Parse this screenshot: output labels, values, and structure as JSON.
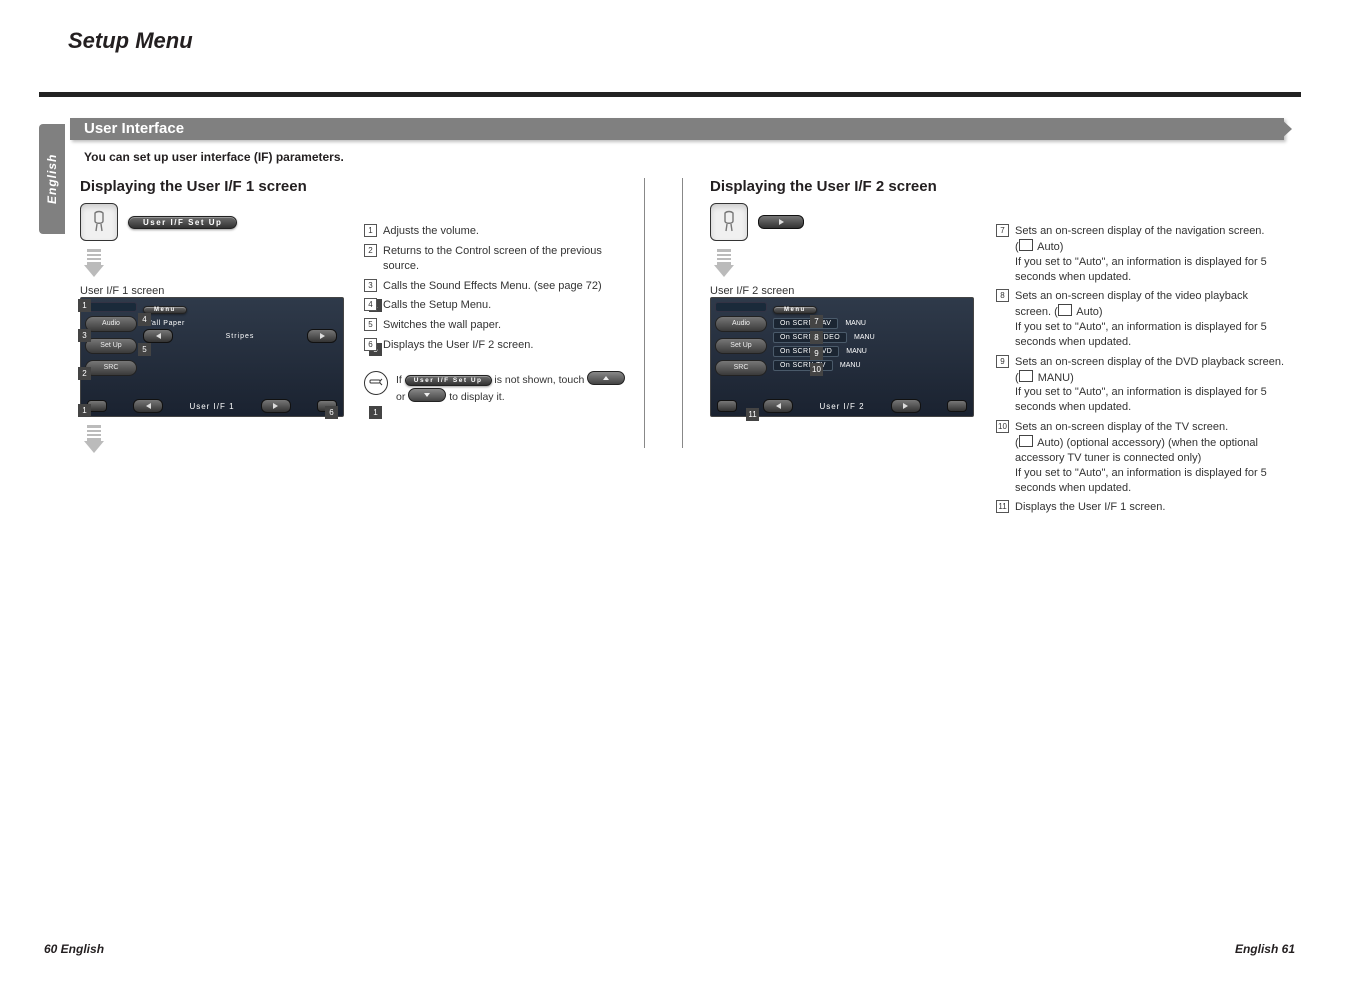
{
  "page": {
    "title": "Setup Menu",
    "sideTab": "English",
    "sectionBar": "User Interface",
    "intro": "You can set up user interface (IF) parameters.",
    "footerLeft": "60 English",
    "footerRight": "English 61"
  },
  "left": {
    "heading": "Displaying the User I/F 1 screen",
    "pillLabel": "User I/F Set Up",
    "screenCaption": "User I/F 1 screen",
    "screen": {
      "sideButtons": [
        "Audio",
        "Set Up",
        "SRC"
      ],
      "menuPill": "Menu",
      "wallPaperLabel": "Wall Paper",
      "wallPaperValue": "Stripes",
      "bottomTitle": "User I/F 1"
    },
    "descriptions": [
      {
        "num": "1",
        "text": "Adjusts the volume."
      },
      {
        "num": "2",
        "text": "Returns to the Control screen of the previous source."
      },
      {
        "num": "3",
        "text": "Calls the Sound Effects Menu. (see page 72)"
      },
      {
        "num": "4",
        "text": "Calls the Setup Menu."
      },
      {
        "num": "5",
        "text": "Switches the wall paper."
      },
      {
        "num": "6",
        "text": "Displays the User I/F 2 screen."
      }
    ],
    "note": {
      "prefix": "If",
      "pill": "User I/F Set Up",
      "mid": "is not shown, touch",
      "suffix": "to display it."
    }
  },
  "right": {
    "heading": "Displaying the User I/F 2 screen",
    "screenCaption": "User I/F 2 screen",
    "screen": {
      "sideButtons": [
        "Audio",
        "Set Up",
        "SRC"
      ],
      "menuPill": "Menu",
      "rows": [
        {
          "label": "On SCRN NAV",
          "value": "MANU"
        },
        {
          "label": "On SCRN VIDEO",
          "value": "MANU"
        },
        {
          "label": "On SCRN DVD",
          "value": "MANU"
        },
        {
          "label": "On SCRN TV",
          "value": "MANU"
        }
      ],
      "bottomTitle": "User I/F 2"
    },
    "descriptions": [
      {
        "num": "7",
        "text": "Sets an on-screen display of the navigation screen.",
        "default": "Auto",
        "auto": "If you set to \"Auto\", an information is displayed for 5 seconds when updated."
      },
      {
        "num": "8",
        "text": "Sets an on-screen display of the video playback screen.",
        "default": "Auto",
        "auto": "If you set to \"Auto\", an information is displayed for 5 seconds when updated."
      },
      {
        "num": "9",
        "text": "Sets an on-screen display of the DVD playback screen.",
        "default": "MANU",
        "auto": "If you set to \"Auto\", an information is displayed for 5 seconds when updated."
      },
      {
        "num": "10",
        "text": "Sets an on-screen display of the TV screen.",
        "default": "Auto",
        "extra": "(optional accessory) (when the optional accessory TV tuner is connected only)",
        "auto": "If you set to \"Auto\", an information is displayed for 5 seconds when updated."
      },
      {
        "num": "11",
        "text": "Displays the User I/F 1 screen."
      }
    ]
  }
}
